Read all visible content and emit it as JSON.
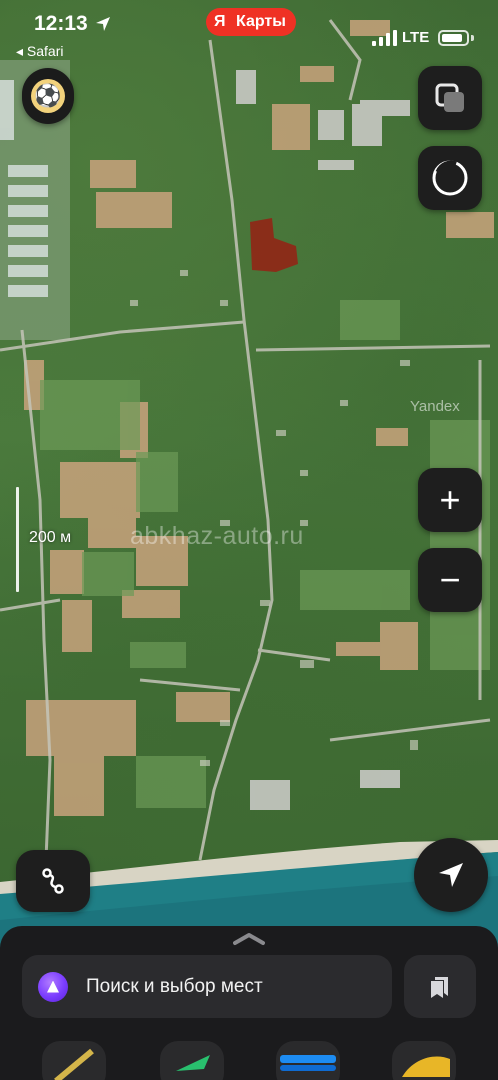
{
  "status_bar": {
    "time": "12:13",
    "back_app": "◂ Safari",
    "network": "LTE",
    "battery_level": 0.85
  },
  "brand": {
    "logo_letter": "Я",
    "name": "Карты",
    "color": "#ef3124"
  },
  "map": {
    "watermark": "abkhaz-auto.ru",
    "provider_mark": "Yandex",
    "scale_label": "200 м",
    "highlight_color": "#9b1b12",
    "sea_color": "#1f7f86"
  },
  "controls": {
    "zoom_in": "+",
    "zoom_out": "−",
    "icons": [
      "soccer-ball-avatar",
      "layers-icon",
      "compass-icon",
      "route-icon",
      "navigation-arrow-icon",
      "bookmarks-icon"
    ]
  },
  "bottom_sheet": {
    "search_placeholder": "Поиск и выбор мест",
    "assistant_icon": "alice-icon"
  }
}
